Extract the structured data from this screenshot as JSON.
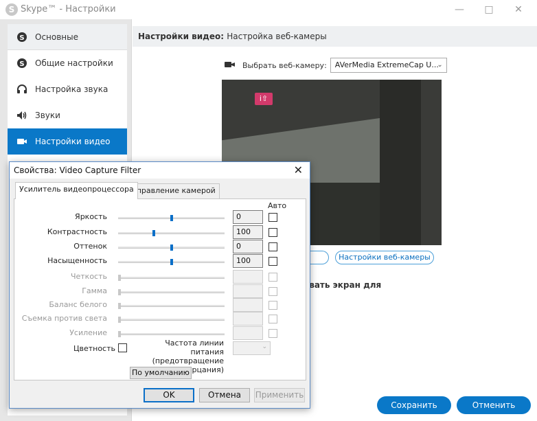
{
  "window": {
    "app_icon": "skype-icon",
    "title": "Skype™ - Настройки"
  },
  "sidebar": {
    "header": {
      "label": "Основные",
      "icon": "skype-icon"
    },
    "items": [
      {
        "label": "Общие настройки",
        "icon": "skype-icon"
      },
      {
        "label": "Настройка звука",
        "icon": "headphones-icon"
      },
      {
        "label": "Звуки",
        "icon": "speaker-icon"
      },
      {
        "label": "Настройки видео",
        "icon": "video-camera-icon",
        "active": true
      }
    ]
  },
  "main": {
    "header_title": "Настройки видео:",
    "header_subtitle": "Настройка веб-камеры",
    "camera_label": "Выбрать веб-камеру:",
    "camera_selected": "AVerMedia ExtremeCap U...",
    "webcam_settings_button": "Настройки веб-камеры",
    "share_text": "ировать экран для",
    "save_button": "Сохранить",
    "cancel_button": "Отменить"
  },
  "dialog": {
    "title": "Свойства: Video Capture Filter",
    "tabs": [
      {
        "label": "Усилитель видеопроцессора",
        "active": true
      },
      {
        "label": "Управление камерой",
        "active": false
      }
    ],
    "auto_header": "Авто",
    "properties": [
      {
        "label": "Яркость",
        "value": "0",
        "position": 0.5,
        "enabled": true
      },
      {
        "label": "Контрастность",
        "value": "100",
        "position": 0.33,
        "enabled": true
      },
      {
        "label": "Оттенок",
        "value": "0",
        "position": 0.5,
        "enabled": true
      },
      {
        "label": "Насыщенность",
        "value": "100",
        "position": 0.5,
        "enabled": true
      },
      {
        "label": "Четкость",
        "value": "",
        "position": 0,
        "enabled": false
      },
      {
        "label": "Гамма",
        "value": "",
        "position": 0,
        "enabled": false
      },
      {
        "label": "Баланс белого",
        "value": "",
        "position": 0,
        "enabled": false
      },
      {
        "label": "Съемка против света",
        "value": "",
        "position": 0,
        "enabled": false
      },
      {
        "label": "Усиление",
        "value": "",
        "position": 0,
        "enabled": false
      }
    ],
    "color_label": "Цветность",
    "freq_label": "Частота линии питания (предотвращение мерцания)",
    "default_button": "По умолчанию",
    "ok_button": "OK",
    "cancel_button": "Отмена",
    "apply_button": "Применить"
  },
  "colors": {
    "accent": "#0a78c8",
    "preview_badge": "#d23a6b"
  }
}
